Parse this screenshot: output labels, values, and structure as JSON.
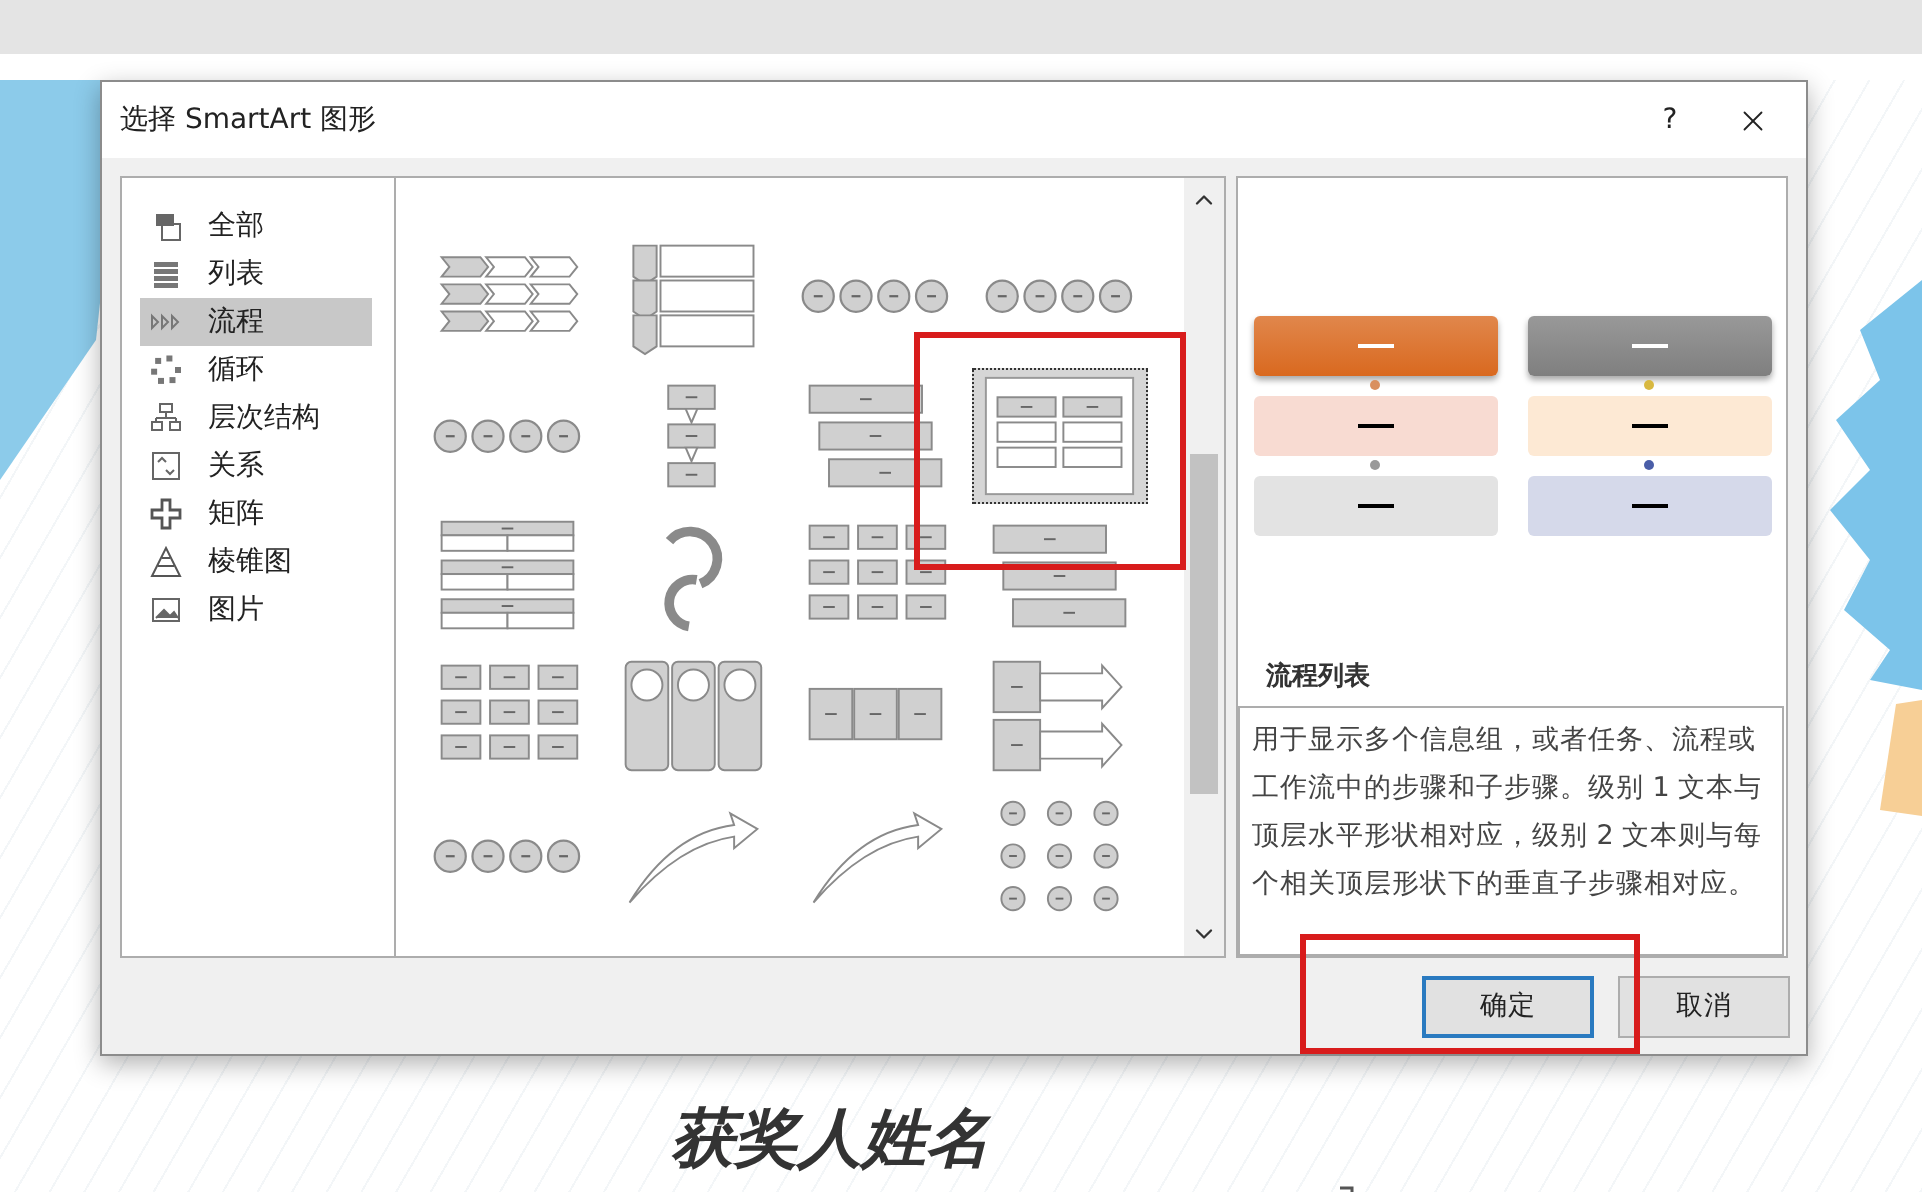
{
  "dialog": {
    "title": "选择 SmartArt 图形",
    "help": "?"
  },
  "categories": [
    {
      "label": "全部",
      "selected": false
    },
    {
      "label": "列表",
      "selected": false
    },
    {
      "label": "流程",
      "selected": true
    },
    {
      "label": "循环",
      "selected": false
    },
    {
      "label": "层次结构",
      "selected": false
    },
    {
      "label": "关系",
      "selected": false
    },
    {
      "label": "矩阵",
      "selected": false
    },
    {
      "label": "棱锥图",
      "selected": false
    },
    {
      "label": "图片",
      "selected": false
    }
  ],
  "gallery": {
    "items": [
      {
        "kind": "chevrons",
        "selected": false
      },
      {
        "kind": "tag-list",
        "selected": false
      },
      {
        "kind": "circles",
        "selected": false
      },
      {
        "kind": "circles",
        "selected": false
      },
      {
        "kind": "circles",
        "selected": false
      },
      {
        "kind": "arrow-column",
        "selected": false
      },
      {
        "kind": "stair",
        "selected": false
      },
      {
        "kind": "two-column",
        "selected": true
      },
      {
        "kind": "bands",
        "selected": false
      },
      {
        "kind": "cycle",
        "selected": false
      },
      {
        "kind": "box-grid",
        "selected": false
      },
      {
        "kind": "stair",
        "selected": false
      },
      {
        "kind": "box-grid",
        "selected": false
      },
      {
        "kind": "pillars",
        "selected": false
      },
      {
        "kind": "box-row",
        "selected": false
      },
      {
        "kind": "box-arrows",
        "selected": false
      },
      {
        "kind": "circles",
        "selected": false
      },
      {
        "kind": "curve",
        "selected": false
      },
      {
        "kind": "curve",
        "selected": false
      },
      {
        "kind": "circle-matrix",
        "selected": false
      }
    ]
  },
  "preview": {
    "columns": [
      {
        "boxes": [
          {
            "color": "#d9691f"
          },
          {
            "color": "#f8dbd2"
          },
          {
            "color": "#e3e3e3"
          }
        ],
        "connectors": [
          {
            "color": "#d99060"
          },
          {
            "color": "#999999"
          }
        ]
      },
      {
        "boxes": [
          {
            "color": "#7f7f7f"
          },
          {
            "color": "#fde9d4"
          },
          {
            "color": "#d5d9ea"
          }
        ],
        "connectors": [
          {
            "color": "#d8b840"
          },
          {
            "color": "#4a5ea8"
          }
        ]
      }
    ],
    "name": "流程列表",
    "description": "用于显示多个信息组，或者任务、流程或工作流中的步骤和子步骤。级别 1 文本与顶层水平形状相对应，级别 2 文本则与每个相关顶层形状下的垂直子步骤相对应。"
  },
  "buttons": [
    {
      "label": "确定",
      "default": true
    },
    {
      "label": "取消",
      "default": false
    }
  ],
  "slide": {
    "title": "获奖人姓名"
  }
}
